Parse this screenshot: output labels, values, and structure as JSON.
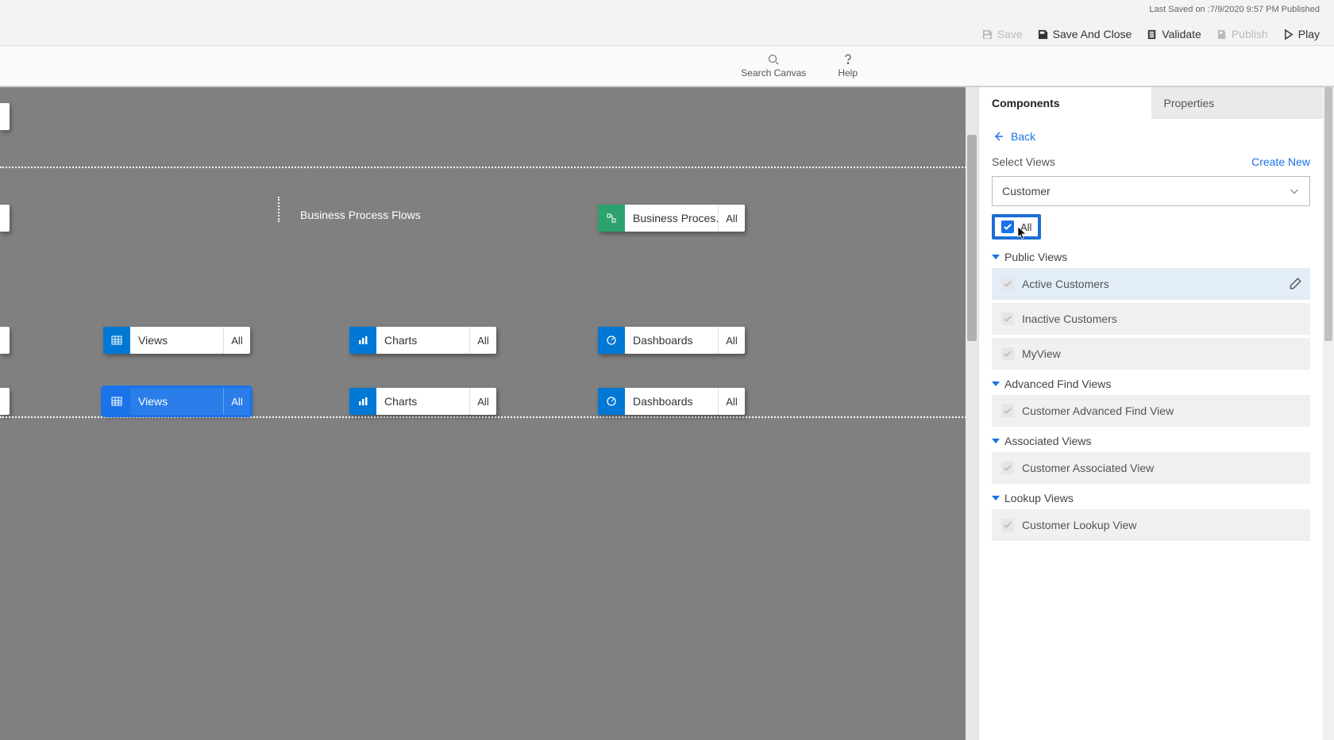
{
  "topbar": {
    "status_text": "Last Saved on :7/9/2020 9:57 PM Published",
    "save": "Save",
    "save_and_close": "Save And Close",
    "validate": "Validate",
    "publish": "Publish",
    "play": "Play"
  },
  "subbar": {
    "search": "Search Canvas",
    "help": "Help"
  },
  "canvas": {
    "bpf_label": "Business Process Flows",
    "bpf_box": {
      "label": "Business Proces...",
      "ext": "All"
    },
    "row1": [
      {
        "label": "Views",
        "ext": "All"
      },
      {
        "label": "Charts",
        "ext": "All"
      },
      {
        "label": "Dashboards",
        "ext": "All"
      }
    ],
    "row2": [
      {
        "label": "Views",
        "ext": "All"
      },
      {
        "label": "Charts",
        "ext": "All"
      },
      {
        "label": "Dashboards",
        "ext": "All"
      }
    ]
  },
  "panel": {
    "tabs": {
      "components": "Components",
      "properties": "Properties"
    },
    "back": "Back",
    "select_views": "Select Views",
    "create_new": "Create New",
    "dropdown_value": "Customer",
    "all_label": "All",
    "groups": [
      {
        "title": "Public Views",
        "items": [
          {
            "label": "Active Customers",
            "hovered": true,
            "editable": true
          },
          {
            "label": "Inactive Customers"
          },
          {
            "label": "MyView"
          }
        ]
      },
      {
        "title": "Advanced Find Views",
        "items": [
          {
            "label": "Customer Advanced Find View"
          }
        ]
      },
      {
        "title": "Associated Views",
        "items": [
          {
            "label": "Customer Associated View"
          }
        ]
      },
      {
        "title": "Lookup Views",
        "items": [
          {
            "label": "Customer Lookup View"
          }
        ]
      }
    ]
  }
}
